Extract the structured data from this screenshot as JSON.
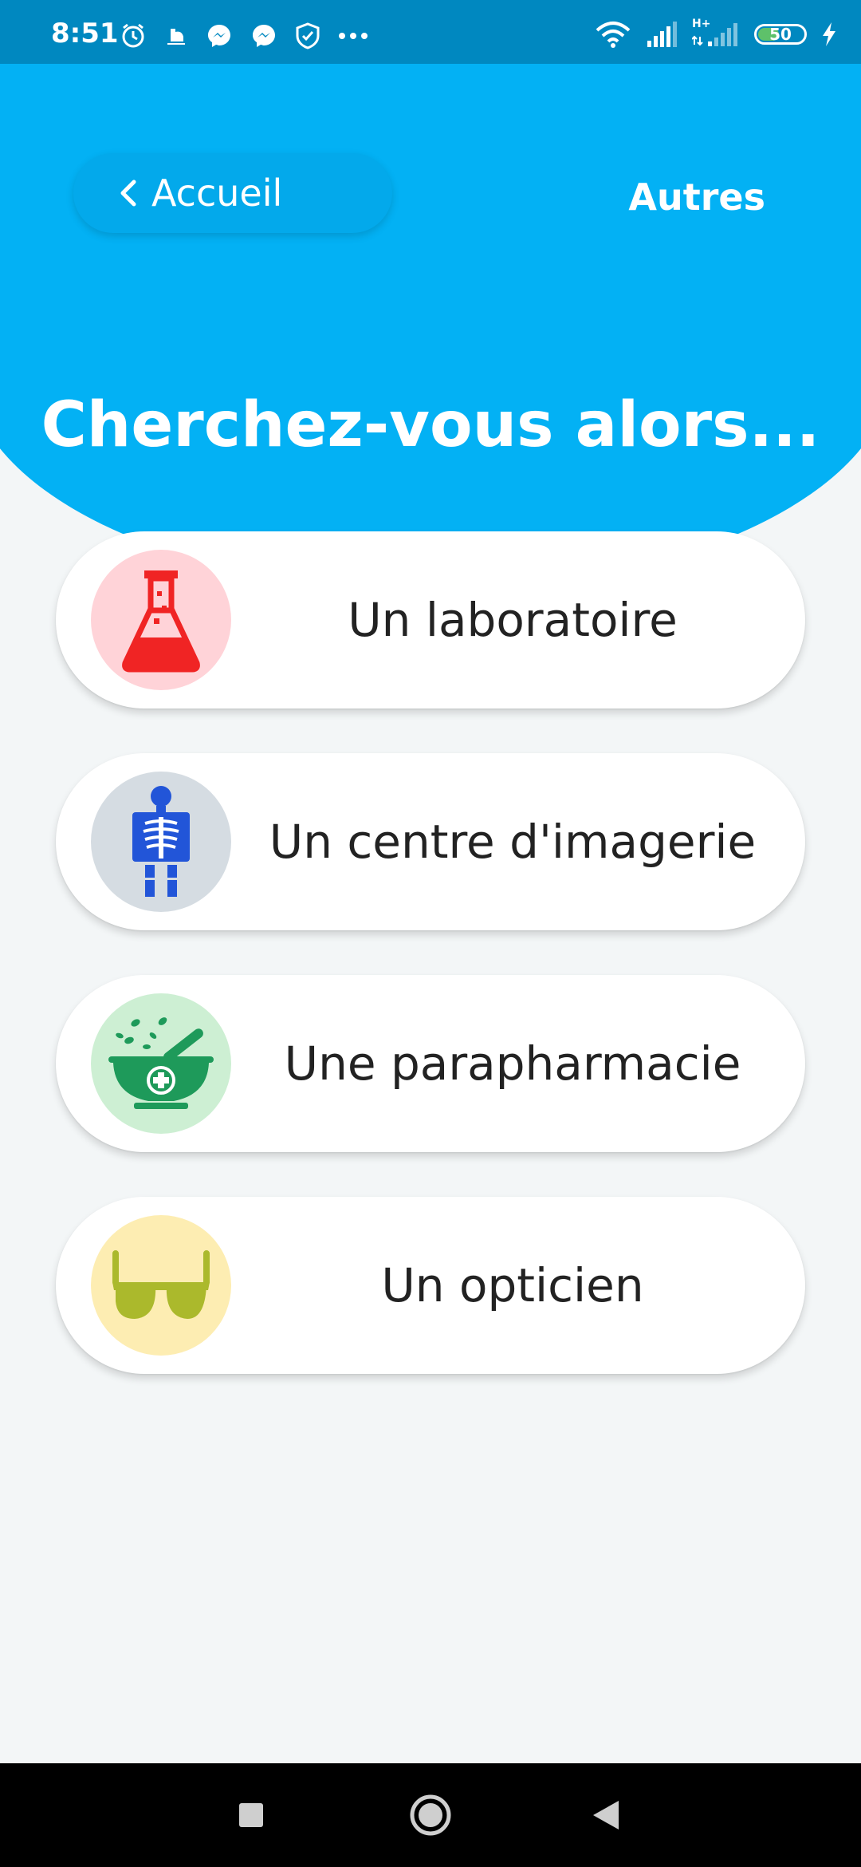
{
  "status_bar": {
    "time": "8:51",
    "left_icons": [
      "alarm-icon",
      "weather-icon",
      "messenger-icon",
      "messenger-icon",
      "shield-icon",
      "more-dots-icon"
    ],
    "right_icons": [
      "wifi-icon",
      "signal-icon",
      "signal-hplus-icon",
      "battery-icon",
      "charging-icon"
    ],
    "network_label": "H+",
    "battery_level": 50,
    "battery_text": "50"
  },
  "header": {
    "back_label": "Accueil",
    "other_label": "Autres",
    "title": "Cherchez-vous alors..."
  },
  "options": [
    {
      "label": "Un laboratoire",
      "icon": "flask-icon",
      "icon_bg": "#FFD3D8",
      "icon_color": "#F02424"
    },
    {
      "label": "Un centre d'imagerie",
      "icon": "xray-icon",
      "icon_bg": "#D5DCE2",
      "icon_color": "#2255D8"
    },
    {
      "label": "Une parapharmacie",
      "icon": "mortar-pestle-icon",
      "icon_bg": "#CDEFD3",
      "icon_color": "#1E9A5A"
    },
    {
      "label": "Un opticien",
      "icon": "glasses-icon",
      "icon_bg": "#FDEDB2",
      "icon_color": "#ABB92C"
    }
  ],
  "colors": {
    "primary": "#03B1F4",
    "status_bar": "#0088C0",
    "background": "#F3F6F7"
  },
  "nav_bar": {
    "buttons": [
      "recents-icon",
      "home-icon",
      "back-icon"
    ]
  }
}
